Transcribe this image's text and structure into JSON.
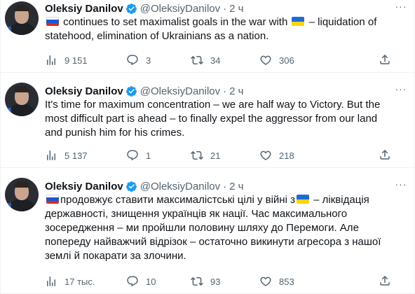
{
  "tweets": [
    {
      "author": "Oleksiy Danilov",
      "handle": "@OleksiyDanilov",
      "separator": "·",
      "time": "2 ч",
      "lines": [
        {
          "flag_start": "ru",
          "text": " continues to set maximalist goals in the war with ",
          "flag_end": "ua",
          "text_after": " – liquidation of"
        },
        {
          "text": "statehood, elimination of Ukrainians as a nation."
        }
      ],
      "views": "9 151",
      "replies": "3",
      "retweets": "34",
      "likes": "306"
    },
    {
      "author": "Oleksiy Danilov",
      "handle": "@OleksiyDanilov",
      "separator": "·",
      "time": "2 ч",
      "lines": [
        {
          "text": "It's time for maximum concentration – we are half way to Victory. But the"
        },
        {
          "text": "most difficult part is ahead – to finally expel the aggressor from our land"
        },
        {
          "text": "and punish him for his crimes."
        }
      ],
      "views": "5 137",
      "replies": "1",
      "retweets": "21",
      "likes": "218"
    },
    {
      "author": "Oleksiy Danilov",
      "handle": "@OleksiyDanilov",
      "separator": "·",
      "time": "2 ч",
      "lines": [
        {
          "flag_start": "ru",
          "text": "продовжує ставити максималістські цілі у війні з",
          "flag_end": "ua",
          "text_after": " – ліквідація"
        },
        {
          "text": "державності, знищення українців як нації. Час максимального"
        },
        {
          "text": "зосередження – ми пройшли половину шляху до Перемоги. Але"
        },
        {
          "text": "попереду найважчий відрізок – остаточно викинути агресора з нашої"
        },
        {
          "text": "землі й покарати за злочини."
        }
      ],
      "views": "17 тыс.",
      "replies": "10",
      "retweets": "93",
      "likes": "853"
    }
  ],
  "icons": {
    "verified": "verified-badge-icon",
    "more": "more-icon",
    "views": "views-chart-icon",
    "reply": "reply-icon",
    "retweet": "retweet-icon",
    "like": "heart-icon",
    "share": "share-icon"
  },
  "colors": {
    "text": "#0f1419",
    "secondary": "#536471",
    "verified": "#1d9bf0",
    "divider": "#eff3f4"
  }
}
